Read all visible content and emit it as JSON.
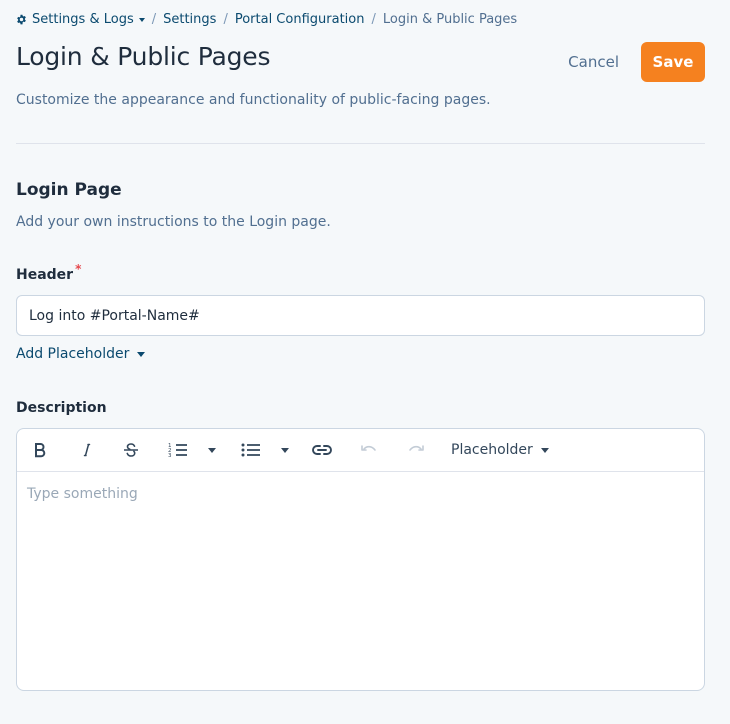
{
  "breadcrumb": {
    "items": [
      {
        "label": "Settings & Logs",
        "icon": "gear-icon",
        "dropdown": true
      },
      {
        "label": "Settings"
      },
      {
        "label": "Portal Configuration"
      }
    ],
    "separator": "/",
    "current": "Login & Public Pages"
  },
  "page": {
    "title": "Login & Public Pages",
    "subtitle": "Customize the appearance and functionality of public-facing pages.",
    "cancel_label": "Cancel",
    "save_label": "Save"
  },
  "login_section": {
    "title": "Login Page",
    "description": "Add your own instructions to the Login page.",
    "header_label": "Header",
    "required_mark": "*",
    "header_value": "Log into #Portal-Name#",
    "add_placeholder_label": "Add Placeholder",
    "description_label": "Description",
    "editor": {
      "toolbar": [
        "bold-icon",
        "italic-icon",
        "strikethrough-icon",
        "numbered-list-icon",
        "bullet-list-icon",
        "link-icon",
        "undo-icon",
        "redo-icon"
      ],
      "placeholder_menu_label": "Placeholder",
      "body_placeholder": "Type something"
    }
  },
  "colors": {
    "accent_orange": "#f5811f",
    "link_blue": "#0b4a6f",
    "background": "#f5f8fa",
    "required_red": "#e5484d"
  }
}
